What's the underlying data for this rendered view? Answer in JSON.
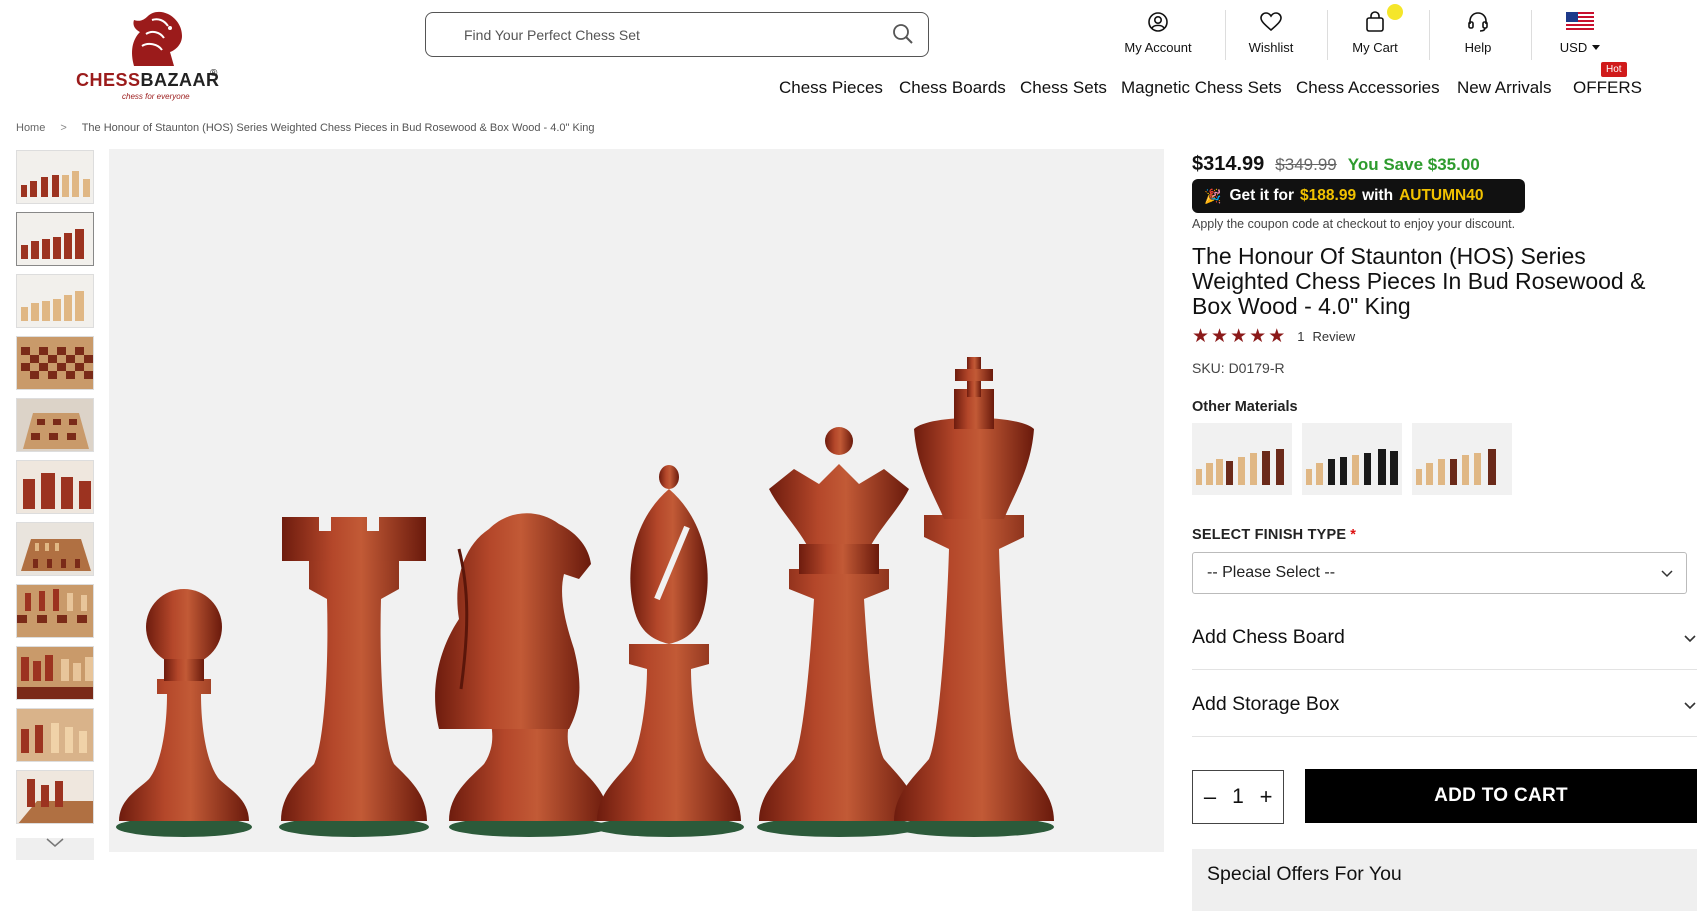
{
  "brand": {
    "name_left": "CHESS",
    "name_right": "BAZAAR",
    "registered": "®",
    "tagline": "chess for everyone",
    "accent_color": "#9b1b1b"
  },
  "search": {
    "placeholder": "Find Your Perfect Chess Set",
    "icon": "search-icon"
  },
  "utility": {
    "account": "My Account",
    "wishlist": "Wishlist",
    "cart": "My Cart",
    "help": "Help",
    "currency": "USD"
  },
  "nav": {
    "items": [
      "Chess Pieces",
      "Chess Boards",
      "Chess Sets",
      "Magnetic Chess Sets",
      "Chess Accessories",
      "New Arrivals",
      "OFFERS"
    ],
    "hot_badge": "Hot"
  },
  "breadcrumb": {
    "home": "Home",
    "separator": ">",
    "current": "The Honour of Staunton (HOS) Series Weighted Chess Pieces in Bud Rosewood & Box Wood - 4.0\" King"
  },
  "product": {
    "price": "$314.99",
    "price_old": "$349.99",
    "save": "You Save $35.00",
    "coupon": {
      "prefix": "Get it for",
      "price": "$188.99",
      "mid": "with",
      "code": "AUTUMN40"
    },
    "coupon_note": "Apply the coupon code at checkout to enjoy your discount.",
    "title": "The Honour Of Staunton (HOS) Series Weighted Chess Pieces In Bud Rosewood & Box Wood - 4.0\" King",
    "rating": 5,
    "review_count": "1",
    "review_label": "Review",
    "sku": "SKU: D0179-R",
    "other_materials_label": "Other Materials",
    "finish_label": "SELECT FINISH TYPE",
    "finish_required": "*",
    "finish_value": "-- Please Select --",
    "add_board": "Add Chess Board",
    "add_box": "Add Storage Box",
    "quantity": "1",
    "qty_minus": "–",
    "qty_plus": "+",
    "add_to_cart": "ADD TO CART",
    "special_offers": "Special Offers For You"
  },
  "colors": {
    "price_save": "#2e9b2e",
    "coupon_highlight": "#f2c200",
    "star": "#8b1a1a",
    "hot": "#d01b1b",
    "rosewood": "#9c3320"
  }
}
